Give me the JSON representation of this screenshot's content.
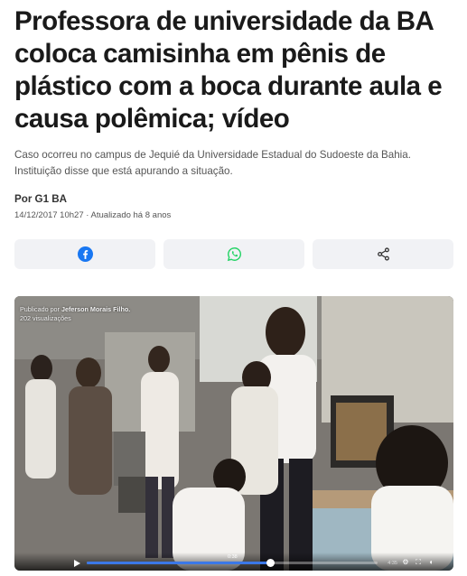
{
  "article": {
    "headline": "Professora de universidade da BA coloca camisinha em pênis de plástico com a boca durante aula e causa polêmica; vídeo",
    "subheadline": "Caso ocorreu no campus de Jequié da Universidade Estadual do Sudoeste da Bahia. Instituição disse que está apurando a situação.",
    "author": "Por G1 BA",
    "dateline": "14/12/2017 10h27 · Atualizado há 8 anos"
  },
  "share": {
    "buttons": [
      {
        "icon": "facebook-icon",
        "color": "#1877f2"
      },
      {
        "icon": "whatsapp-icon",
        "color": "#25d366"
      },
      {
        "icon": "share-icon",
        "color": "#333333"
      }
    ]
  },
  "video": {
    "published_prefix": "Publicado por",
    "publisher": "Jeferson Morais Filho.",
    "views": "202 visualizações",
    "scrub_time": "0:38",
    "end_time": "4:35",
    "progress_fraction": 0.63
  }
}
